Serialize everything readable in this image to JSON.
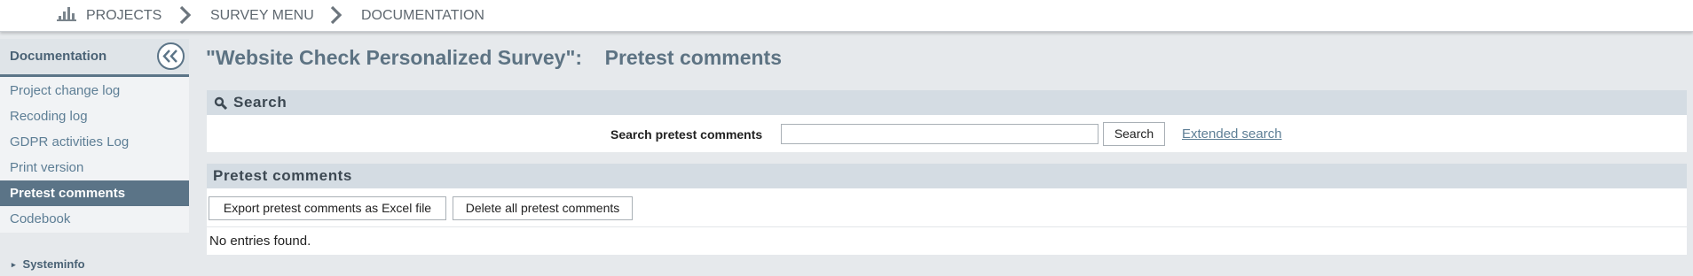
{
  "breadcrumb": {
    "items": [
      "PROJECTS",
      "SURVEY MENU",
      "DOCUMENTATION"
    ]
  },
  "sidebar": {
    "title": "Documentation",
    "items": [
      {
        "label": "Project change log",
        "active": false
      },
      {
        "label": "Recoding log",
        "active": false
      },
      {
        "label": "GDPR activities Log",
        "active": false
      },
      {
        "label": "Print version",
        "active": false
      },
      {
        "label": "Pretest comments",
        "active": true
      },
      {
        "label": "Codebook",
        "active": false
      }
    ],
    "systeminfo_label": "Systeminfo"
  },
  "page": {
    "title": "\"Website Check Personalized Survey\":    Pretest comments"
  },
  "search_panel": {
    "heading": "Search",
    "field_label": "Search pretest comments",
    "input_value": "",
    "search_button": "Search",
    "extended_link": "Extended search"
  },
  "comments_panel": {
    "heading": "Pretest comments",
    "export_button": "Export pretest comments as Excel file",
    "delete_button": "Delete all pretest comments",
    "empty_text": "No entries found."
  },
  "colors": {
    "accent": "#5b7487",
    "link": "#5d7e95",
    "panel_header": "#d4dce3",
    "background": "#e6e9ec"
  }
}
